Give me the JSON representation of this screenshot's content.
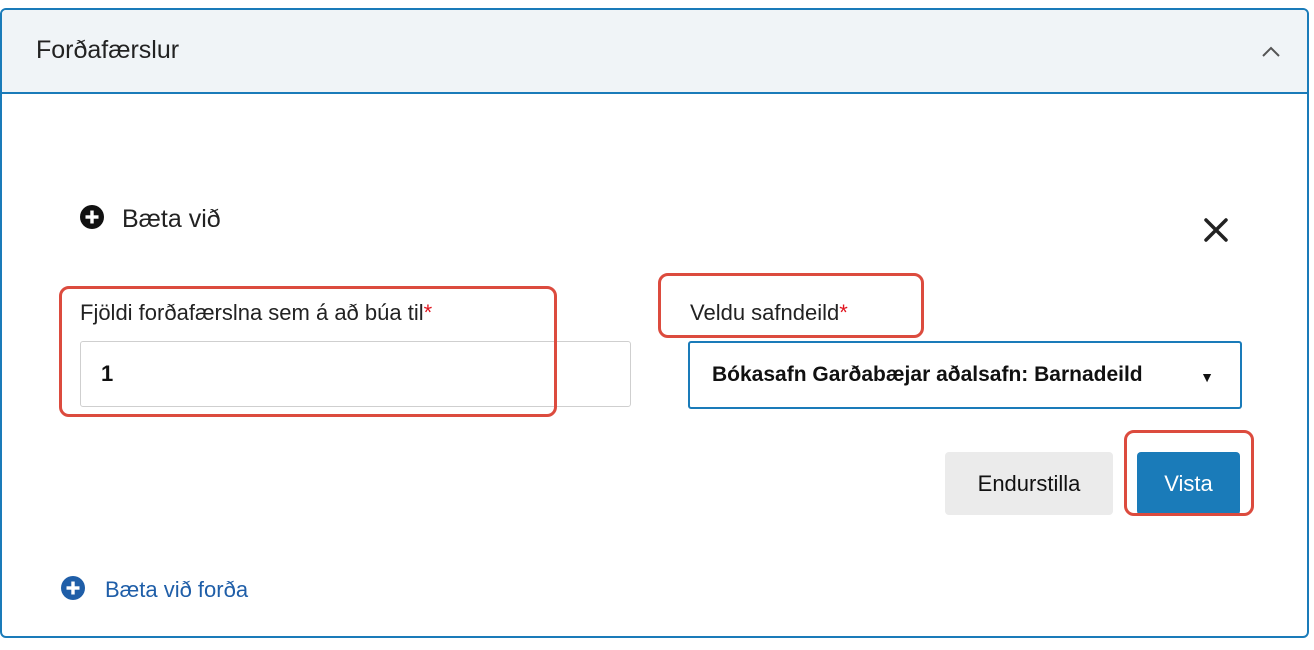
{
  "panel": {
    "title": "Forðafærslur",
    "collapse_icon": "chevron-up-icon"
  },
  "add_section": {
    "heading": "Bæta við",
    "heading_icon": "plus-circle-icon",
    "close_icon": "close-icon"
  },
  "form": {
    "count_field": {
      "label": "Fjöldi forðafærslna sem á að búa til",
      "required_mark": "*",
      "value": "1"
    },
    "library_field": {
      "label": "Veldu safndeild",
      "required_mark": "*",
      "selected": "Bókasafn Garðabæjar aðalsafn: Barnadeild",
      "caret_icon": "caret-down-icon"
    },
    "reset_label": "Endurstilla",
    "save_label": "Vista"
  },
  "add_link": {
    "label": "Bæta við forða",
    "icon": "plus-circle-icon"
  },
  "colors": {
    "accent": "#1a7bb9",
    "header_bg": "#f0f4f7",
    "required": "#e0141e",
    "link": "#1f5ea8",
    "highlight": "#dc4b3e"
  }
}
